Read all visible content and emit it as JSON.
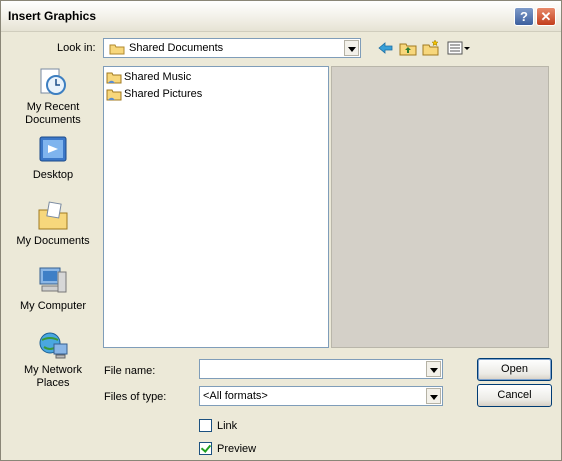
{
  "window": {
    "title": "Insert Graphics",
    "help_label": "?",
    "close_label": "✕"
  },
  "look_in": {
    "label": "Look in:",
    "value": "Shared Documents"
  },
  "places": [
    {
      "label": "My Recent Documents"
    },
    {
      "label": "Desktop"
    },
    {
      "label": "My Documents"
    },
    {
      "label": "My Computer"
    },
    {
      "label": "My Network Places"
    }
  ],
  "files": [
    {
      "name": "Shared Music"
    },
    {
      "name": "Shared Pictures"
    }
  ],
  "file_name": {
    "label": "File name:",
    "value": ""
  },
  "files_of_type": {
    "label": "Files of type:",
    "value": "<All formats>"
  },
  "buttons": {
    "open": "Open",
    "cancel": "Cancel"
  },
  "options": {
    "link": {
      "label": "Link",
      "checked": false
    },
    "preview": {
      "label": "Preview",
      "checked": true
    }
  }
}
